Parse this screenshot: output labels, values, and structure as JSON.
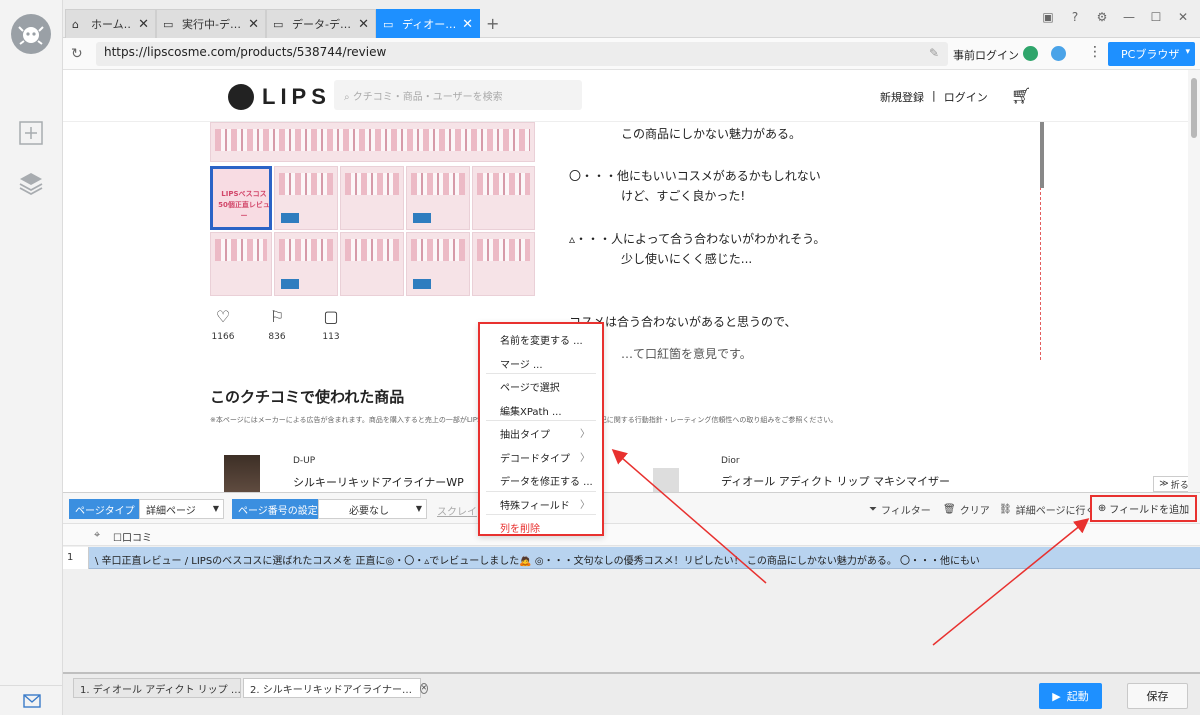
{
  "tabs": [
    {
      "label": "ホーム…",
      "icon": "home-icon"
    },
    {
      "label": "実行中-デ…",
      "icon": "page-icon"
    },
    {
      "label": "データ-デ…",
      "icon": "page-icon"
    },
    {
      "label": "ディオー…",
      "icon": "page-icon"
    }
  ],
  "address": {
    "url": "https://lipscosme.com/products/538744/review",
    "login_label": "事前ログイン",
    "browser_label": "PCブラウザ"
  },
  "site": {
    "brand": "LIPS",
    "search_placeholder": "クチコミ・商品・ユーザーを検索",
    "register": "新規登録",
    "separator": "|",
    "login": "ログイン",
    "gallery_selected_text": "LIPSベスコス 50個正直レビュー",
    "reactions": [
      {
        "icon": "heart-icon",
        "count": "1166"
      },
      {
        "icon": "bookmark-icon",
        "count": "836"
      },
      {
        "icon": "comment-icon",
        "count": "113"
      }
    ],
    "review_lines": [
      "この商品にしかない魅力がある。",
      "〇・・・他にもいいコスメがあるかもしれない",
      "けど、すごく良かった!",
      "▵・・・人によって合う合わないがわかれそう。",
      "少し使いにくく感じた...",
      "コスメは合う合わないがあると思うので、",
      "…て口紅箇を意見です。"
    ],
    "used_title": "このクチコミで使われた商品",
    "disclaimer": "※本ページにはメーカーによる広告が含まれます。商品を購入すると売上の一部がLIPSに還元されることがあります。広告表記に関する行動指針・レーティング信頼性への取り組みをご参照ください。",
    "product1": {
      "brand": "D-UP",
      "name": "シルキーリキッドアイライナーWP"
    },
    "product2": {
      "brand": "Dior",
      "name": "ディオール アディクト リップ マキシマイザー"
    },
    "fold": "折る"
  },
  "toolbar": {
    "page_type_label": "ページタイプ",
    "page_type_value": "詳細ページ",
    "page_num_label": "ページ番号の設定",
    "page_num_value": "必要なし",
    "scroll_label": "スクレイ",
    "filter": "フィルター",
    "clear": "クリア",
    "go_detail": "詳細ページに行く",
    "add_field": "フィールドを追加"
  },
  "grid": {
    "column": "口コミ",
    "rows": [
      {
        "num": "1",
        "text": "\\ 辛口正直レビュー /  LIPSのベスコスに選ばれたコスメを  正直に◎・〇・▵でレビューしました🙇  ◎・・・文句なしの優秀コスメ！リピしたい！ この商品にしかない魅力がある。  〇・・・他にもい"
      }
    ]
  },
  "context_menu": [
    {
      "label": "名前を変更する ...",
      "sep": false,
      "sub": false
    },
    {
      "label": "マージ ...",
      "sep": true,
      "sub": false
    },
    {
      "label": "ページで選択",
      "sep": false,
      "sub": false
    },
    {
      "label": "編集XPath ...",
      "sep": true,
      "sub": false
    },
    {
      "label": "抽出タイプ",
      "sep": false,
      "sub": true
    },
    {
      "label": "デコードタイプ",
      "sep": false,
      "sub": true
    },
    {
      "label": "データを修正する ...",
      "sep": true,
      "sub": false
    },
    {
      "label": "特殊フィールド",
      "sep": true,
      "sub": true
    },
    {
      "label": "列を削除",
      "sep": false,
      "sub": false,
      "danger": true
    }
  ],
  "bottom": {
    "tab1": "1. ディオール アディクト リップ …",
    "tab2": "2. シルキーリキッドアイライナー…",
    "start": "起動",
    "save": "保存"
  },
  "colors": {
    "accent": "#1e90ff",
    "highlight_red": "#e8312f",
    "row_selected": "#b8d3ef"
  }
}
